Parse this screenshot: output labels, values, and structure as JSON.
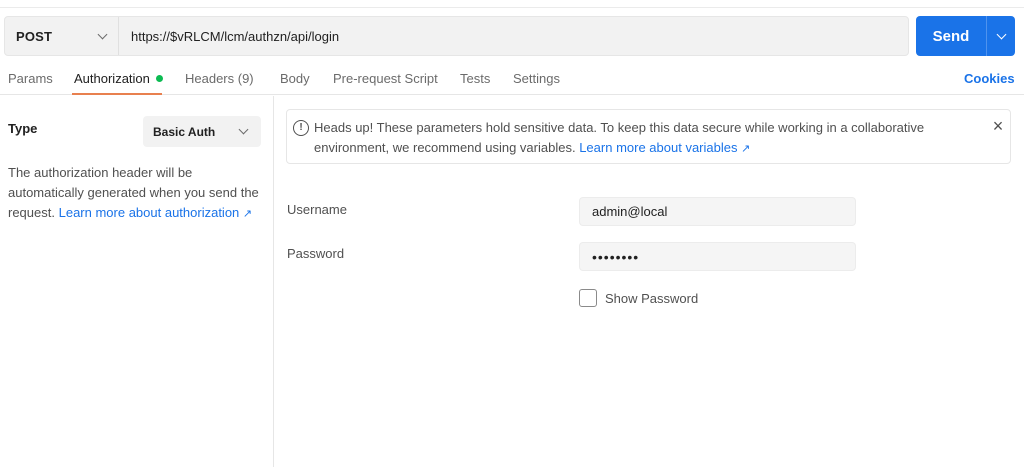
{
  "request": {
    "method": "POST",
    "url": "https://$vRLCM/lcm/authzn/api/login",
    "send_label": "Send"
  },
  "tabs": [
    {
      "label": "Params",
      "active": false
    },
    {
      "label": "Authorization",
      "active": true,
      "indicator": "green-dot"
    },
    {
      "label": "Headers (9)",
      "active": false
    },
    {
      "label": "Body",
      "active": false
    },
    {
      "label": "Pre-request Script",
      "active": false
    },
    {
      "label": "Tests",
      "active": false
    },
    {
      "label": "Settings",
      "active": false
    }
  ],
  "cookies_label": "Cookies",
  "auth": {
    "type_label": "Type",
    "type_value": "Basic Auth",
    "description": "The authorization header will be automatically generated when you send the request.",
    "learn_more": "Learn more about authorization"
  },
  "notice": {
    "text": "Heads up! These parameters hold sensitive data. To keep this data secure while working in a collaborative environment, we recommend using variables.",
    "link": "Learn more about variables"
  },
  "form": {
    "username_label": "Username",
    "username_value": "admin@local",
    "password_label": "Password",
    "password_value": "••••••••",
    "show_password_label": "Show Password",
    "show_password_checked": false
  },
  "colors": {
    "accent": "#1a73e8",
    "active_tab_underline": "#e8804f",
    "status_dot": "#0cbb52"
  }
}
